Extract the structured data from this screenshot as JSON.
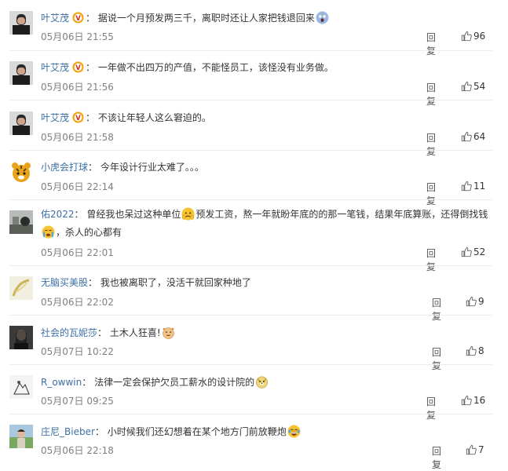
{
  "comments": [
    {
      "user": "叶艾茂",
      "verified": true,
      "text": "据说一个月预发两三千，离职时还让人家把钱退回来",
      "emoji": "😱",
      "time": "05月06日 21:55",
      "reply": "回复",
      "likes": "96"
    },
    {
      "user": "叶艾茂",
      "verified": true,
      "text": "一年做不出四万的产值，不能怪员工，该怪没有业务做。",
      "emoji": "",
      "time": "05月06日 21:56",
      "reply": "回复",
      "likes": "54"
    },
    {
      "user": "叶艾茂",
      "verified": true,
      "text": "不该让年轻人这么窘迫的。",
      "emoji": "",
      "time": "05月06日 21:58",
      "reply": "回复",
      "likes": "64"
    },
    {
      "user": "小虎会打球",
      "verified": false,
      "text": "今年设计行业太难了。。。",
      "emoji": "",
      "time": "05月06日 22:14",
      "reply": "回复",
      "likes": "11"
    },
    {
      "user": "佑2022",
      "verified": false,
      "text_a": "曾经我也呆过这种单位",
      "text_b": "预发工资，熬一年就盼年底的的那一笔钱，结果年底算账，还得倒找钱",
      "text_c": "，杀人的心都有",
      "time": "05月06日 22:01",
      "reply": "回复",
      "likes": "52"
    },
    {
      "user": "无脑买美股",
      "verified": false,
      "text": "我也被离职了，没活干就回家种地了",
      "emoji": "",
      "time": "05月06日 22:02",
      "reply": "回复",
      "likes": "9"
    },
    {
      "user": "社会的瓦妮莎",
      "verified": false,
      "text": "土木人狂喜!",
      "emoji": "😸",
      "time": "05月07日 10:22",
      "reply": "回复",
      "likes": "8"
    },
    {
      "user": "R_owwin",
      "verified": false,
      "text": "法律一定会保护欠员工薪水的设计院的",
      "emoji": "😏",
      "time": "05月07日 09:25",
      "reply": "回复",
      "likes": "16"
    },
    {
      "user": "庄尼_Bieber",
      "verified": false,
      "text": "小时候我们还幻想着在某个地方门前放鞭炮",
      "emoji": "😂",
      "time": "05月06日 22:18",
      "reply": "回复",
      "likes": "7"
    }
  ],
  "colors": {
    "name": "#3d6fa5",
    "time": "#808080",
    "divider": "#eeeeee",
    "badge": "#f0a30a"
  }
}
